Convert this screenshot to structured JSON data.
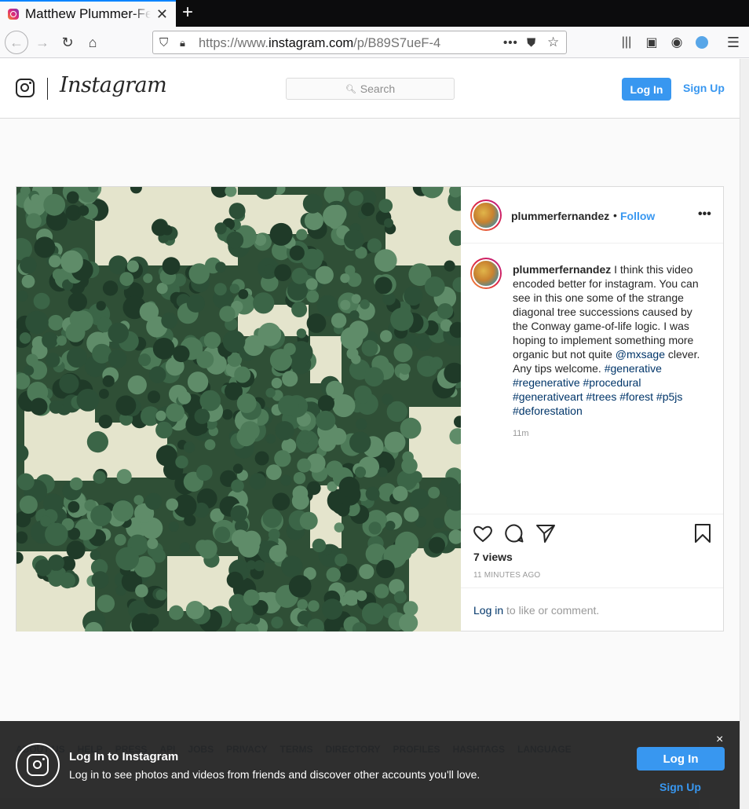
{
  "browser": {
    "tab_title": "Matthew Plummer-Fernandez on Instagram",
    "url_prefix": "https://www.",
    "url_domain": "instagram.com",
    "url_path": "/p/B89S7ueF-4",
    "icons": [
      "back-icon",
      "forward-icon",
      "reload-icon",
      "home-icon",
      "shield-icon",
      "lock-icon",
      "page-actions-icon",
      "pocket-icon",
      "star-icon",
      "library-icon",
      "sidebar-icon",
      "account-icon",
      "extension-icon",
      "menu-icon"
    ]
  },
  "header": {
    "wordmark": "Instagram",
    "search_placeholder": "Search",
    "login_label": "Log In",
    "signup_label": "Sign Up"
  },
  "post": {
    "username": "plummerfernandez",
    "separator": "•",
    "follow_label": "Follow",
    "more_label": "•••",
    "caption_text": " I think this video encoded better for instagram. You can see in this one some of the strange diagonal tree successions caused by the Conway game-of-life logic. I was hoping to implement something more organic but not quite ",
    "mention": "@mxsage",
    "caption_text_2": " clever. Any tips welcome.",
    "hashtags": [
      "#generative",
      "#regenerative",
      "#procedural",
      "#generativeart",
      "#trees",
      "#forest",
      "#p5js",
      "#deforestation"
    ],
    "time_ago": "11m",
    "views": "7 views",
    "posted_ago": "11 MINUTES AGO",
    "comment_login": "Log in",
    "comment_rest": " to like or comment."
  },
  "footer": {
    "links": [
      "ABOUT US",
      "HELP",
      "PRESS",
      "API",
      "JOBS",
      "PRIVACY",
      "TERMS",
      "DIRECTORY",
      "PROFILES",
      "HASHTAGS",
      "LANGUAGE"
    ]
  },
  "banner": {
    "title": "Log In to Instagram",
    "subtitle": "Log in to see photos and videos from friends and discover other accounts you'll love.",
    "close_label": "×",
    "login_label": "Log In",
    "signup_label": "Sign Up"
  },
  "colors": {
    "accent": "#3897f0",
    "link": "#003569",
    "forest": "#2f4f36",
    "clearing": "#e4e4cc"
  }
}
